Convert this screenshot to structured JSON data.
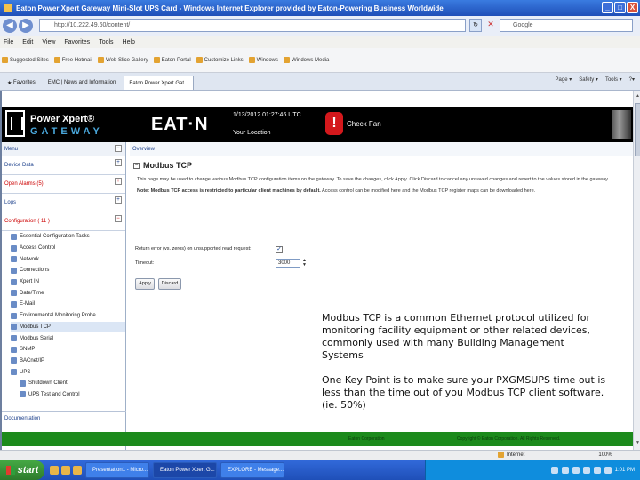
{
  "window": {
    "title": "Eaton Power Xpert Gateway Mini-Slot UPS Card - Windows Internet Explorer provided by Eaton-Powering Business Worldwide",
    "buttons": [
      "_",
      "□",
      "X"
    ]
  },
  "address_bar": {
    "url": "http://10.222.49.60/content/",
    "search_placeholder": "Google"
  },
  "menubar": [
    "File",
    "Edit",
    "View",
    "Favorites",
    "Tools",
    "Help"
  ],
  "favorites_bar": [
    "Suggested Sites",
    "Free Hotmail",
    "Web Slice Gallery",
    "Eaton Portal",
    "Customize Links",
    "Windows",
    "Windows Media"
  ],
  "tabs_bar": {
    "favorites_label": "Favorites",
    "tabs": [
      "EMC | News and Information",
      "Eaton Power Xpert Gat..."
    ],
    "tools": [
      "Page ▾",
      "Safety ▾",
      "Tools ▾",
      "?▾"
    ]
  },
  "header": {
    "product_title": "Power Xpert®",
    "product_sub": "GATEWAY",
    "brand": "EAT·N",
    "datetime": "1/13/2012 01:27:46 UTC",
    "location": "Your Location",
    "alert_icon_glyph": "!",
    "alert_text": "Check Fan"
  },
  "sidebar": {
    "menu_label": "Menu",
    "sections": [
      {
        "label": "Device Data",
        "toggle": "+"
      },
      {
        "label": "Open Alarms (5)",
        "toggle": "+"
      },
      {
        "label": "Logs",
        "toggle": "+"
      },
      {
        "label": "Configuration ( 11 )",
        "toggle": "−"
      }
    ],
    "items": [
      {
        "label": "Essential Configuration Tasks",
        "icon": "config-icon"
      },
      {
        "label": "Access Control",
        "icon": "lock-icon"
      },
      {
        "label": "Network",
        "icon": "network-icon"
      },
      {
        "label": "Connections",
        "icon": "connections-icon"
      },
      {
        "label": "Xpert IN",
        "icon": "xpert-icon"
      },
      {
        "label": "Date/Time",
        "icon": "clock-icon"
      },
      {
        "label": "E-Mail",
        "icon": "mail-icon"
      },
      {
        "label": "Environmental Monitoring Probe",
        "icon": "probe-icon"
      },
      {
        "label": "Modbus TCP",
        "icon": "modbus-icon",
        "selected": true
      },
      {
        "label": "Modbus Serial",
        "icon": "serial-icon"
      },
      {
        "label": "SNMP",
        "icon": "snmp-icon"
      },
      {
        "label": "BACnet/IP",
        "icon": "bacnet-icon"
      },
      {
        "label": "UPS",
        "icon": "ups-icon"
      }
    ],
    "sub_items": [
      {
        "label": "Shutdown Client",
        "icon": "shutdown-icon"
      },
      {
        "label": "UPS Test and Control",
        "icon": "test-icon"
      }
    ],
    "bottom_label": "Documentation"
  },
  "main": {
    "overview_label": "Overview",
    "section_title": "Modbus TCP",
    "collapse_glyph": "−",
    "description": "This page may be used to change various Modbus TCP configuration items on the gateway. To save the changes, click Apply. Click Discard to cancel any unsaved changes and revert to the values stored in the gateway.",
    "note_bold": "Note: Modbus TCP access is restricted to particular client machines by default.",
    "note_rest": " Access control can be modified here and the Modbus TCP register maps can be downloaded here.",
    "form": {
      "return_error_label": "Return error (vs. zeros) on unsupported read request:",
      "return_error_checked": true,
      "check_glyph": "✓",
      "timeout_label": "Timeout:",
      "timeout_value": "3000",
      "spin_up": "▲",
      "spin_down": "▼"
    },
    "apply_label": "Apply",
    "discard_label": "Discard"
  },
  "overlay": {
    "para1": "Modbus TCP is a common Ethernet protocol utilized for monitoring facility equipment or other related devices, commonly used with many Building Management Systems",
    "para2": "One Key Point is to make sure your PXGMSUPS time out is less than the time out of you Modbus TCP client software. (ie. 50%)"
  },
  "footer": {
    "left": "Eaton Corporation",
    "right": "Copyright © Eaton Corporation. All Rights Reserved."
  },
  "statusbar": {
    "zone": "Internet",
    "zoom": "100%"
  },
  "taskbar": {
    "start_label": "start",
    "tasks": [
      "Presentation1 - Micro...",
      "Eaton Power Xpert G...",
      "EXPLORE - Message..."
    ],
    "help_glyph": "?",
    "clock": "1:01 PM"
  },
  "colors": {
    "header_bg": "#000000",
    "footer_green": "#1c8a1c",
    "alert_red": "#d4181c",
    "xp_blue": "#1f4fb8"
  }
}
